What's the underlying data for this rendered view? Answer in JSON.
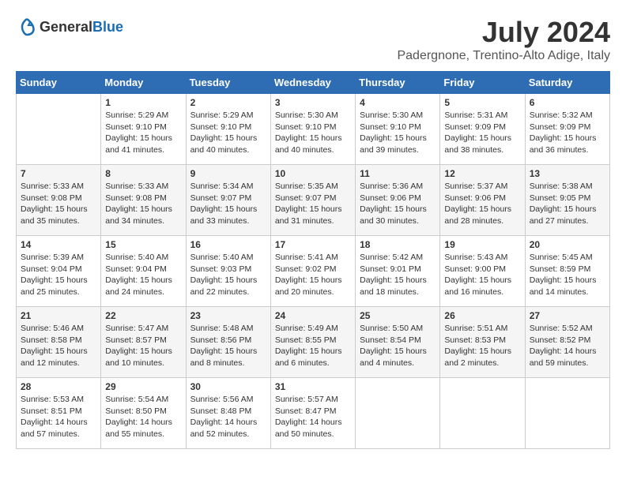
{
  "header": {
    "logo_general": "General",
    "logo_blue": "Blue",
    "month_year": "July 2024",
    "location": "Padergnone, Trentino-Alto Adige, Italy"
  },
  "calendar": {
    "days_of_week": [
      "Sunday",
      "Monday",
      "Tuesday",
      "Wednesday",
      "Thursday",
      "Friday",
      "Saturday"
    ],
    "weeks": [
      [
        {
          "day": "",
          "info": ""
        },
        {
          "day": "1",
          "info": "Sunrise: 5:29 AM\nSunset: 9:10 PM\nDaylight: 15 hours\nand 41 minutes."
        },
        {
          "day": "2",
          "info": "Sunrise: 5:29 AM\nSunset: 9:10 PM\nDaylight: 15 hours\nand 40 minutes."
        },
        {
          "day": "3",
          "info": "Sunrise: 5:30 AM\nSunset: 9:10 PM\nDaylight: 15 hours\nand 40 minutes."
        },
        {
          "day": "4",
          "info": "Sunrise: 5:30 AM\nSunset: 9:10 PM\nDaylight: 15 hours\nand 39 minutes."
        },
        {
          "day": "5",
          "info": "Sunrise: 5:31 AM\nSunset: 9:09 PM\nDaylight: 15 hours\nand 38 minutes."
        },
        {
          "day": "6",
          "info": "Sunrise: 5:32 AM\nSunset: 9:09 PM\nDaylight: 15 hours\nand 36 minutes."
        }
      ],
      [
        {
          "day": "7",
          "info": "Sunrise: 5:33 AM\nSunset: 9:08 PM\nDaylight: 15 hours\nand 35 minutes."
        },
        {
          "day": "8",
          "info": "Sunrise: 5:33 AM\nSunset: 9:08 PM\nDaylight: 15 hours\nand 34 minutes."
        },
        {
          "day": "9",
          "info": "Sunrise: 5:34 AM\nSunset: 9:07 PM\nDaylight: 15 hours\nand 33 minutes."
        },
        {
          "day": "10",
          "info": "Sunrise: 5:35 AM\nSunset: 9:07 PM\nDaylight: 15 hours\nand 31 minutes."
        },
        {
          "day": "11",
          "info": "Sunrise: 5:36 AM\nSunset: 9:06 PM\nDaylight: 15 hours\nand 30 minutes."
        },
        {
          "day": "12",
          "info": "Sunrise: 5:37 AM\nSunset: 9:06 PM\nDaylight: 15 hours\nand 28 minutes."
        },
        {
          "day": "13",
          "info": "Sunrise: 5:38 AM\nSunset: 9:05 PM\nDaylight: 15 hours\nand 27 minutes."
        }
      ],
      [
        {
          "day": "14",
          "info": "Sunrise: 5:39 AM\nSunset: 9:04 PM\nDaylight: 15 hours\nand 25 minutes."
        },
        {
          "day": "15",
          "info": "Sunrise: 5:40 AM\nSunset: 9:04 PM\nDaylight: 15 hours\nand 24 minutes."
        },
        {
          "day": "16",
          "info": "Sunrise: 5:40 AM\nSunset: 9:03 PM\nDaylight: 15 hours\nand 22 minutes."
        },
        {
          "day": "17",
          "info": "Sunrise: 5:41 AM\nSunset: 9:02 PM\nDaylight: 15 hours\nand 20 minutes."
        },
        {
          "day": "18",
          "info": "Sunrise: 5:42 AM\nSunset: 9:01 PM\nDaylight: 15 hours\nand 18 minutes."
        },
        {
          "day": "19",
          "info": "Sunrise: 5:43 AM\nSunset: 9:00 PM\nDaylight: 15 hours\nand 16 minutes."
        },
        {
          "day": "20",
          "info": "Sunrise: 5:45 AM\nSunset: 8:59 PM\nDaylight: 15 hours\nand 14 minutes."
        }
      ],
      [
        {
          "day": "21",
          "info": "Sunrise: 5:46 AM\nSunset: 8:58 PM\nDaylight: 15 hours\nand 12 minutes."
        },
        {
          "day": "22",
          "info": "Sunrise: 5:47 AM\nSunset: 8:57 PM\nDaylight: 15 hours\nand 10 minutes."
        },
        {
          "day": "23",
          "info": "Sunrise: 5:48 AM\nSunset: 8:56 PM\nDaylight: 15 hours\nand 8 minutes."
        },
        {
          "day": "24",
          "info": "Sunrise: 5:49 AM\nSunset: 8:55 PM\nDaylight: 15 hours\nand 6 minutes."
        },
        {
          "day": "25",
          "info": "Sunrise: 5:50 AM\nSunset: 8:54 PM\nDaylight: 15 hours\nand 4 minutes."
        },
        {
          "day": "26",
          "info": "Sunrise: 5:51 AM\nSunset: 8:53 PM\nDaylight: 15 hours\nand 2 minutes."
        },
        {
          "day": "27",
          "info": "Sunrise: 5:52 AM\nSunset: 8:52 PM\nDaylight: 14 hours\nand 59 minutes."
        }
      ],
      [
        {
          "day": "28",
          "info": "Sunrise: 5:53 AM\nSunset: 8:51 PM\nDaylight: 14 hours\nand 57 minutes."
        },
        {
          "day": "29",
          "info": "Sunrise: 5:54 AM\nSunset: 8:50 PM\nDaylight: 14 hours\nand 55 minutes."
        },
        {
          "day": "30",
          "info": "Sunrise: 5:56 AM\nSunset: 8:48 PM\nDaylight: 14 hours\nand 52 minutes."
        },
        {
          "day": "31",
          "info": "Sunrise: 5:57 AM\nSunset: 8:47 PM\nDaylight: 14 hours\nand 50 minutes."
        },
        {
          "day": "",
          "info": ""
        },
        {
          "day": "",
          "info": ""
        },
        {
          "day": "",
          "info": ""
        }
      ]
    ]
  }
}
